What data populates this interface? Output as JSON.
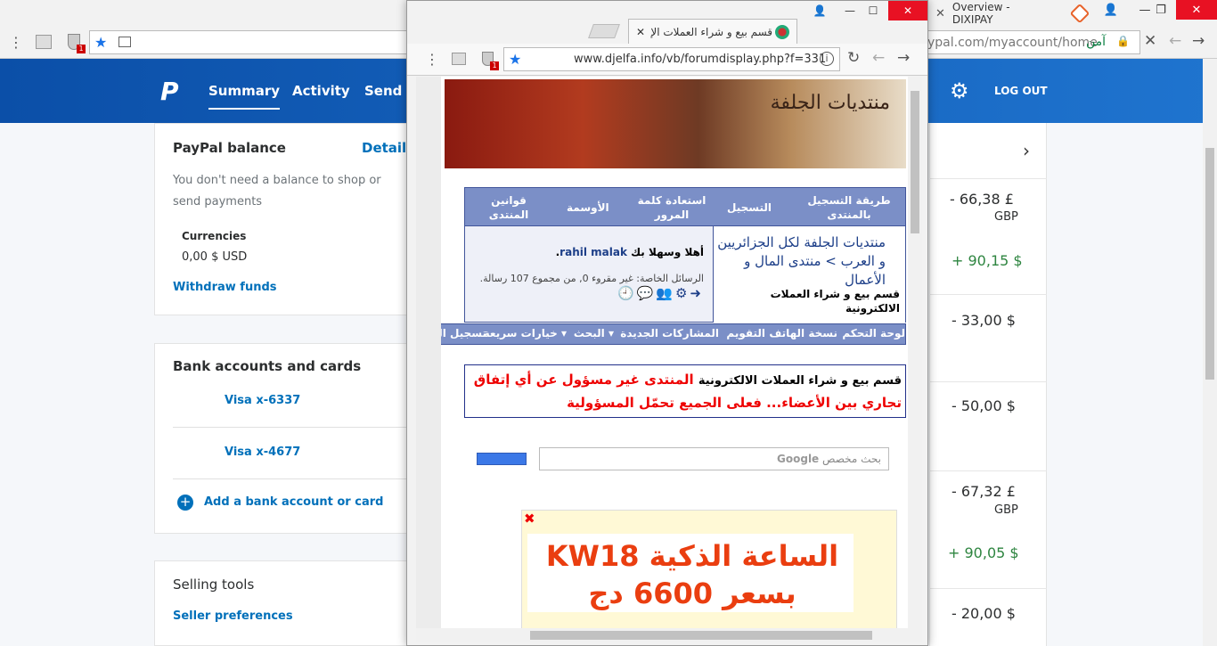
{
  "background_browser": {
    "tab_title": "Overview - DIXIPAY",
    "tab_close": "✕",
    "url_tail": "ypal.com/myaccount/home",
    "secure_label": "آمن",
    "window_buttons": {
      "user": "👤",
      "minimize": "—",
      "restore": "❐",
      "close": "✕"
    },
    "ext_badge": "1"
  },
  "paypal": {
    "logo": "P",
    "nav": {
      "summary": "Summary",
      "activity": "Activity",
      "send": "Send &"
    },
    "logout": "LOG OUT",
    "balance_card": {
      "title": "PayPal balance",
      "details": "Details",
      "desc": "You don't need a balance to shop or send payments",
      "currencies_label": "Currencies",
      "currency_value": "0,00 $ USD",
      "withdraw": "Withdraw funds"
    },
    "bank_card": {
      "title": "Bank accounts and cards",
      "cards": [
        "Visa x-6337",
        "Visa x-4677"
      ],
      "add": "Add a bank account or card"
    },
    "selling_card": {
      "title": "Selling tools",
      "link": "Seller preferences"
    },
    "transactions": [
      {
        "amount": "- 66,38 £",
        "currency": "GBP",
        "positive": false
      },
      {
        "amount": "+ 90,15 $",
        "currency": "",
        "positive": true
      },
      {
        "amount": "- 33,00 $",
        "currency": "",
        "positive": false
      },
      {
        "amount": "- 50,00 $",
        "currency": "",
        "positive": false
      },
      {
        "amount": "- 67,32 £",
        "currency": "GBP",
        "positive": false
      },
      {
        "amount": "+ 90,05 $",
        "currency": "",
        "positive": true
      },
      {
        "amount": "- 20,00 $",
        "currency": "",
        "positive": false
      }
    ]
  },
  "popup": {
    "tab_title": "قسم بيع و شراء العملات الإ",
    "tab_close": "✕",
    "url": "www.djelfa.info/vb/forumdisplay.php?f=331",
    "info_icon": "i",
    "ext_badge": "1",
    "window_buttons": {
      "user": "👤",
      "minimize": "—",
      "maximize": "☐",
      "close": "✕"
    },
    "banner_text": "منتديات الجلفة",
    "nav_items": [
      "طريقة التسجيل بالمنتدى",
      "التسجيل",
      "استعادة كلمة المرور",
      "الأوسمة",
      "قوانين المنتدى"
    ],
    "breadcrumb": "منتديات الجلفة لكل الجزائريين و العرب > منتدى المال و الأعمال",
    "current_forum": "قسم بيع و شراء العملات الالكترونية",
    "welcome_prefix": "أهلا وسهلا بك",
    "welcome_user": "rahil malak",
    "pm_text": "الرسائل الخاصة: غير مقروء 0, من مجموع 107 رسالة.",
    "menu_items": [
      "لوحة التحكم",
      "نسخة الهاتف",
      "التقويم",
      "المشاركات الجديدة",
      "البحث ▾",
      "خيارات سريعة ▾",
      "تسجيل الخروج"
    ],
    "notice_prefix": "قسم بيع و شراء العملات الالكترونية",
    "notice_red": "المنتدى غير مسؤول عن أي إتفاق تجاري بين الأعضاء... فعلى الجميع تحمّل المسؤولية",
    "search_google": "Google",
    "search_placeholder": "بحث مخصص",
    "ad_close": "✖",
    "ad_text": "الساعة الذكية KW18 بسعر 6600 دج"
  }
}
